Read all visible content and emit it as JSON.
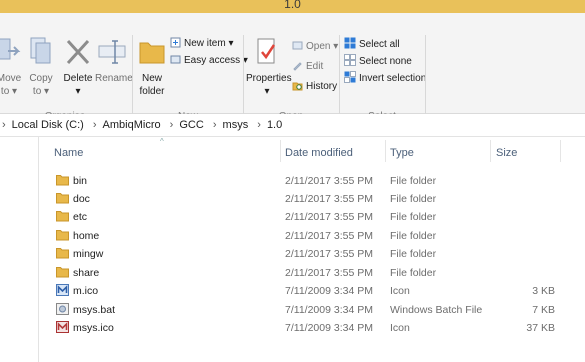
{
  "window": {
    "title": "1.0"
  },
  "ribbon": {
    "organise": {
      "label": "Organise",
      "move_to": [
        "Move",
        "to ▾"
      ],
      "copy_to": [
        "Copy",
        "to ▾"
      ],
      "delete": [
        "Delete",
        "▾"
      ],
      "rename": "Rename"
    },
    "new": {
      "label": "New",
      "new_folder": [
        "New",
        "folder"
      ],
      "new_item": "New item ▾",
      "easy_access": "Easy access ▾"
    },
    "open": {
      "label": "Open",
      "properties": [
        "Properties",
        "▾"
      ],
      "open": "Open ▾",
      "edit": "Edit",
      "history": "History"
    },
    "select": {
      "label": "Select",
      "select_all": "Select all",
      "select_none": "Select none",
      "invert_selection": "Invert selection"
    }
  },
  "address_bar": {
    "crumbs": [
      "Local Disk (C:)",
      "AmbiqMicro",
      "GCC",
      "msys",
      "1.0"
    ]
  },
  "columns": {
    "name": "Name",
    "date": "Date modified",
    "type": "Type",
    "size": "Size"
  },
  "files": [
    {
      "name": "bin",
      "date": "2/11/2017 3:55 PM",
      "type": "File folder",
      "size": "",
      "icon": "folder-icon"
    },
    {
      "name": "doc",
      "date": "2/11/2017 3:55 PM",
      "type": "File folder",
      "size": "",
      "icon": "folder-icon"
    },
    {
      "name": "etc",
      "date": "2/11/2017 3:55 PM",
      "type": "File folder",
      "size": "",
      "icon": "folder-icon"
    },
    {
      "name": "home",
      "date": "2/11/2017 3:55 PM",
      "type": "File folder",
      "size": "",
      "icon": "folder-icon"
    },
    {
      "name": "mingw",
      "date": "2/11/2017 3:55 PM",
      "type": "File folder",
      "size": "",
      "icon": "folder-icon"
    },
    {
      "name": "share",
      "date": "2/11/2017 3:55 PM",
      "type": "File folder",
      "size": "",
      "icon": "folder-icon"
    },
    {
      "name": "m.ico",
      "date": "7/11/2009 3:34 PM",
      "type": "Icon",
      "size": "3 KB",
      "icon": "m-ico-icon"
    },
    {
      "name": "msys.bat",
      "date": "7/11/2009 3:34 PM",
      "type": "Windows Batch File",
      "size": "7 KB",
      "icon": "batch-file-icon"
    },
    {
      "name": "msys.ico",
      "date": "7/11/2009 3:34 PM",
      "type": "Icon",
      "size": "37 KB",
      "icon": "msys-ico-icon"
    }
  ],
  "colors": {
    "title_bar": "#e9c15a",
    "folder": "#e8b84a",
    "header_text": "#4c607a",
    "select_blue": "#2e7bd6"
  }
}
